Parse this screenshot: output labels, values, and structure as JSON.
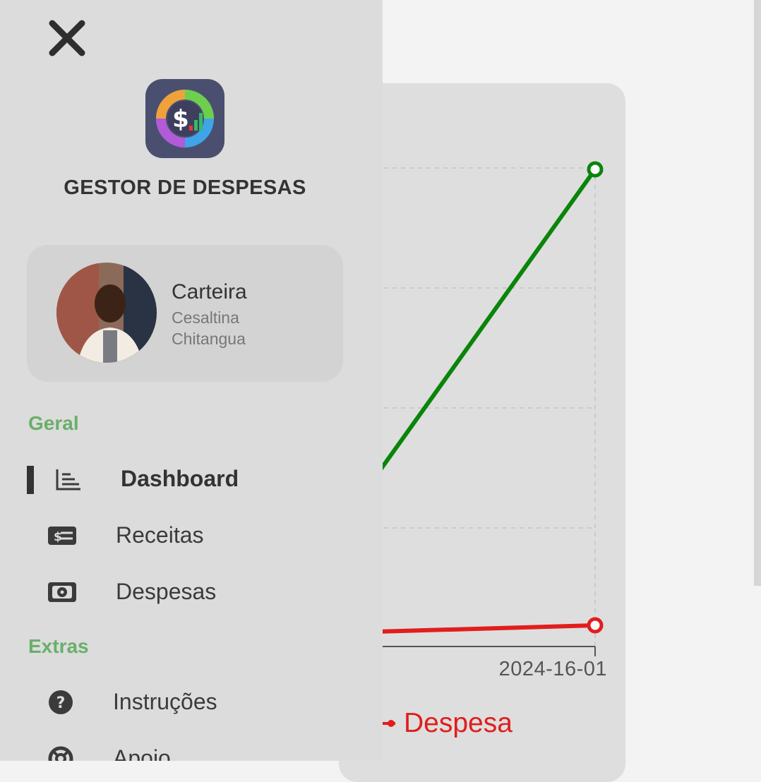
{
  "app": {
    "title": "GESTOR DE DESPESAS"
  },
  "profile": {
    "wallet_label": "Carteira",
    "user_name": "Cesaltina Chitangua"
  },
  "nav": {
    "sections": [
      {
        "title": "Geral"
      },
      {
        "title": "Extras"
      }
    ],
    "items": [
      {
        "label": "Dashboard",
        "icon": "bar-chart-icon",
        "active": true
      },
      {
        "label": "Receitas",
        "icon": "money-bill-icon",
        "active": false
      },
      {
        "label": "Despesas",
        "icon": "money-bill-wave-icon",
        "active": false
      },
      {
        "label": "Instruções",
        "icon": "question-circle-icon",
        "active": false
      },
      {
        "label": "Apoio",
        "icon": "life-ring-icon",
        "active": false
      }
    ]
  },
  "colors": {
    "receita_line": "#0a850a",
    "despesa_line": "#e21d1d",
    "section_title": "#6aaf6a",
    "drawer_bg": "#dcdcdc"
  },
  "chart_data": {
    "type": "line",
    "categories": [
      "2024-16-01"
    ],
    "x_tick_labels": [
      "2024-16-01"
    ],
    "series": [
      {
        "name": "",
        "color": "#0a850a",
        "trend": "rising to max at 2024-16-01"
      },
      {
        "name": "Despesa",
        "color": "#e21d1d",
        "trend": "near zero at 2024-16-01"
      }
    ],
    "legend": [
      {
        "label": "Despesa",
        "color": "#e21d1d"
      }
    ],
    "legend_placement": "bottom",
    "grid": true
  }
}
